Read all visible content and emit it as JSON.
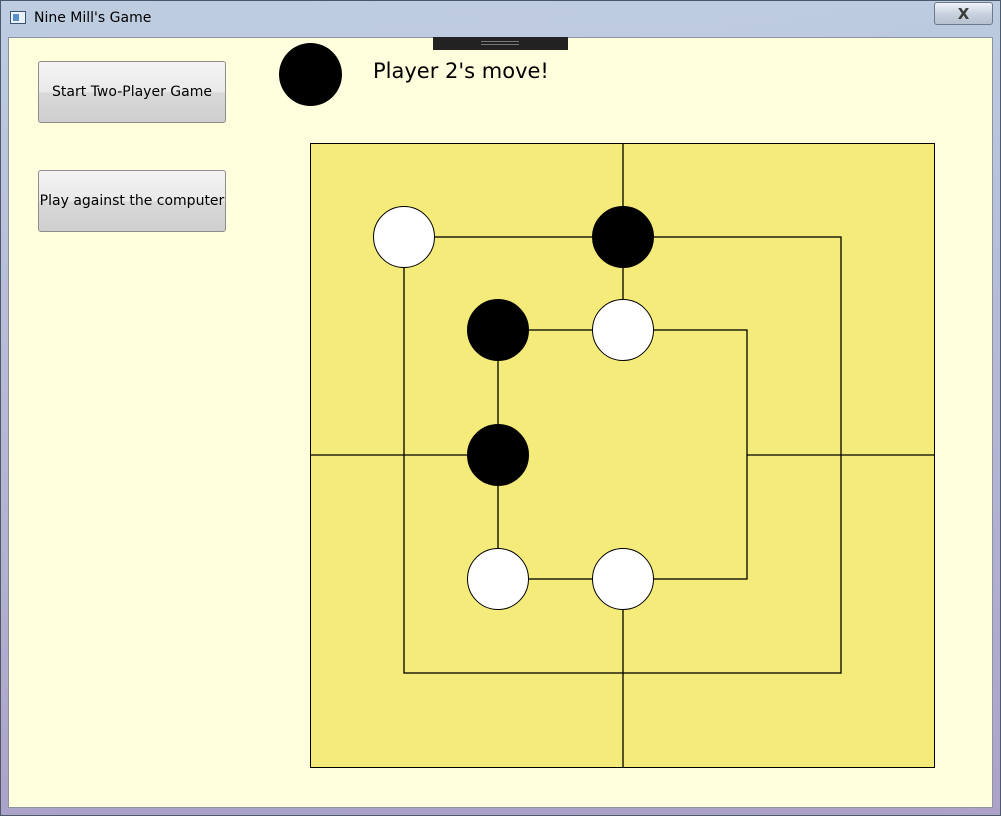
{
  "window": {
    "title": "Nine Mill's Game",
    "close_glyph": "X"
  },
  "buttons": {
    "two_player": "Start Two-Player Game",
    "vs_computer": "Play against the computer"
  },
  "status": {
    "current_player_color": "#000000",
    "message": "Player 2's move!"
  },
  "board": {
    "background_color": "#f4eb7a",
    "line_color": "#000000",
    "white_piece_color": "#ffffff",
    "black_piece_color": "#000000",
    "pieces": [
      {
        "point": "middle-ring-top-left",
        "color": "white"
      },
      {
        "point": "middle-ring-top-center",
        "color": "black"
      },
      {
        "point": "inner-ring-top-left",
        "color": "black"
      },
      {
        "point": "inner-ring-top-center",
        "color": "white"
      },
      {
        "point": "inner-ring-middle-left",
        "color": "black"
      },
      {
        "point": "inner-ring-bottom-left",
        "color": "white"
      },
      {
        "point": "inner-ring-bottom-center",
        "color": "white"
      }
    ]
  }
}
